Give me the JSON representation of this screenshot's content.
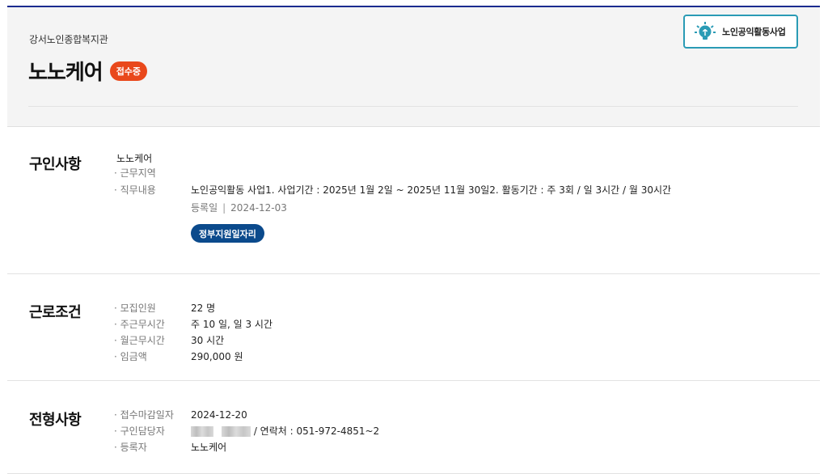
{
  "org_name": "강서노인종합복지관",
  "job_title": "노노케어",
  "status_badge": "접수중",
  "program_badge": {
    "label": "노인공익활동사업",
    "icon": "lightbulb-icon"
  },
  "job_section": {
    "title": "구인사항",
    "job_name": "노노케어",
    "rows": [
      {
        "key": "· 근무지역",
        "value": ""
      },
      {
        "key": "· 직무내용",
        "value": "노인공익활동 사업1. 사업기간 : 2025년 1월 2일 ~ 2025년 11월 30일2. 활동기간 : 주 3회 / 일 3시간 / 월 30시간"
      }
    ],
    "reg_label": "등록일",
    "reg_sep": "|",
    "reg_date": "2024-12-03",
    "tag": "정부지원일자리"
  },
  "work_section": {
    "title": "근로조건",
    "rows": [
      {
        "key": "· 모집인원",
        "value": "22 명"
      },
      {
        "key": "· 주근무시간",
        "value": "주 10 일, 일 3 시간"
      },
      {
        "key": "· 월근무시간",
        "value": "30 시간"
      },
      {
        "key": "· 임금액",
        "value": "290,000 원"
      }
    ]
  },
  "screen_section": {
    "title": "전형사항",
    "rows": [
      {
        "key": "· 접수마감일자",
        "value": "2024-12-20"
      },
      {
        "key": "· 구인담당자",
        "value": "/ 연락처 : 051-972-4851~2"
      },
      {
        "key": "· 등록자",
        "value": "노노케어"
      }
    ]
  },
  "colors": {
    "accent_line": "#1a2b8f",
    "status": "#e9481b",
    "tag": "#0b4a8c",
    "badge_border": "#2a9bb5"
  }
}
